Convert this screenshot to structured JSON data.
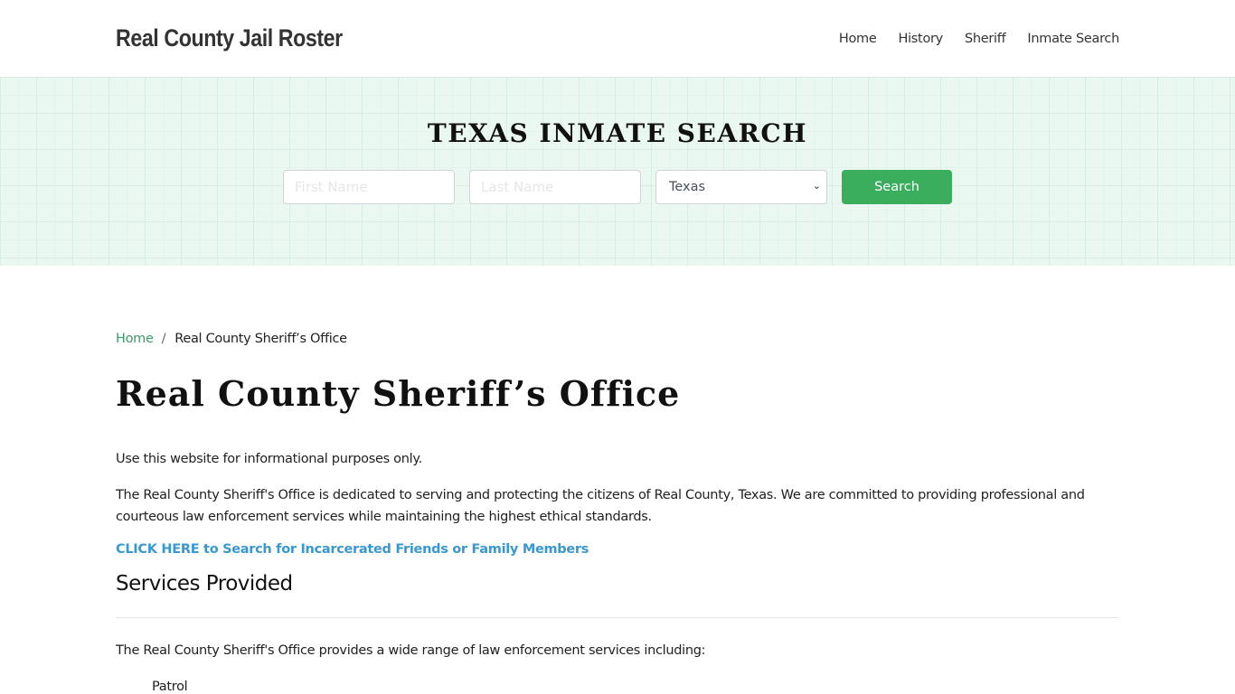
{
  "header": {
    "brand": "Real County Jail Roster",
    "nav": [
      {
        "label": "Home"
      },
      {
        "label": "History"
      },
      {
        "label": "Sheriff"
      },
      {
        "label": "Inmate Search"
      }
    ]
  },
  "hero": {
    "title": "TEXAS INMATE SEARCH",
    "first_name_placeholder": "First Name",
    "last_name_placeholder": "Last Name",
    "state_selected": "Texas",
    "search_label": "Search"
  },
  "breadcrumb": {
    "home": "Home",
    "separator": "/",
    "current": "Real County Sheriff’s Office"
  },
  "page": {
    "title": "Real County Sheriff’s Office",
    "disclaimer": "Use this website for informational purposes only.",
    "intro": "The Real County Sheriff's Office is dedicated to serving and protecting the citizens of Real County, Texas. We are committed to providing professional and courteous law enforcement services while maintaining the highest ethical standards.",
    "cta_link": "CLICK HERE to Search for Incarcerated Friends or Family Members",
    "services_title": "Services Provided",
    "services_intro": "The Real County Sheriff's Office provides a wide range of law enforcement services including:",
    "services": [
      "Patrol"
    ]
  },
  "colors": {
    "accent_green": "#3bae5e",
    "breadcrumb_link": "#3d9a6b",
    "cta_link": "#3a98d0",
    "hero_bg": "#eaf8f1"
  }
}
